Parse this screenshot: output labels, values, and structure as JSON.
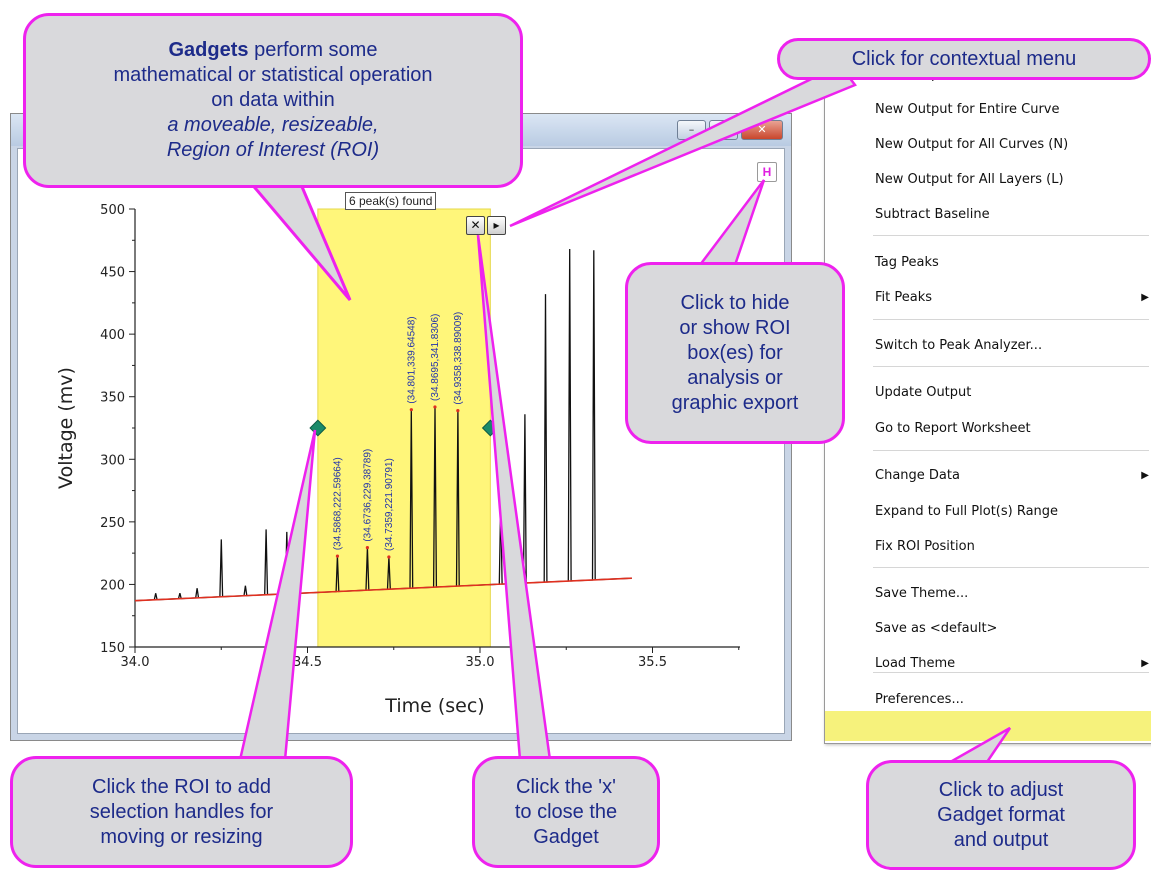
{
  "graph": {
    "window_buttons": {
      "minimize": "–",
      "maximize": "▫",
      "close": "✕"
    },
    "h_button_label": "H",
    "roi_label": "6 peak(s) found",
    "roi_close": "✕",
    "roi_menu": "▸",
    "xlabel": "Time (sec)",
    "ylabel": "Voltage (mv)",
    "x_ticks": [
      "34.0",
      "34.5",
      "35.0",
      "35.5"
    ],
    "y_ticks": [
      "500",
      "450",
      "400",
      "350",
      "300",
      "250",
      "200",
      "150"
    ],
    "peak_labels": [
      "(34.5868,222.59664)",
      "(34.6736,229.38789)",
      "(34.7359,221.90791)",
      "(34.801,339.64548)",
      "(34.8695,341.8306)",
      "(34.9358,338.89009)"
    ]
  },
  "chart_data": {
    "type": "line",
    "xlabel": "Time (sec)",
    "ylabel": "Voltage (mv)",
    "xlim": [
      34.0,
      35.75
    ],
    "ylim": [
      150,
      500
    ],
    "roi": [
      34.53,
      35.03
    ],
    "baseline": {
      "x": [
        34.0,
        35.44
      ],
      "y": [
        187,
        205
      ]
    },
    "peaks": [
      {
        "x": 34.06,
        "y": 193
      },
      {
        "x": 34.13,
        "y": 193
      },
      {
        "x": 34.18,
        "y": 197
      },
      {
        "x": 34.25,
        "y": 236
      },
      {
        "x": 34.32,
        "y": 199
      },
      {
        "x": 34.38,
        "y": 244
      },
      {
        "x": 34.44,
        "y": 242
      },
      {
        "x": 34.5868,
        "y": 222.59664
      },
      {
        "x": 34.6736,
        "y": 229.38789
      },
      {
        "x": 34.7359,
        "y": 221.90791
      },
      {
        "x": 34.801,
        "y": 339.64548
      },
      {
        "x": 34.8695,
        "y": 341.8306
      },
      {
        "x": 34.9358,
        "y": 338.89009
      },
      {
        "x": 35.06,
        "y": 267
      },
      {
        "x": 35.13,
        "y": 336
      },
      {
        "x": 35.19,
        "y": 432
      },
      {
        "x": 35.26,
        "y": 468
      },
      {
        "x": 35.33,
        "y": 467
      }
    ]
  },
  "menu": {
    "items": [
      {
        "label": "New Output (O)",
        "arrow": ""
      },
      {
        "label": "New Output for Entire Curve",
        "arrow": ""
      },
      {
        "label": "New Output for All Curves (N)",
        "arrow": ""
      },
      {
        "label": "New Output for All Layers (L)",
        "arrow": ""
      },
      {
        "label": "Subtract Baseline",
        "arrow": ""
      },
      {
        "label": "Tag Peaks",
        "arrow": ""
      },
      {
        "label": "Fit Peaks",
        "arrow": "▶"
      },
      {
        "label": "Switch to Peak Analyzer...",
        "arrow": ""
      },
      {
        "label": "Update Output",
        "arrow": ""
      },
      {
        "label": "Go to Report Worksheet",
        "arrow": ""
      },
      {
        "label": "Change Data",
        "arrow": "▶"
      },
      {
        "label": "Expand to Full Plot(s) Range",
        "arrow": ""
      },
      {
        "label": "Fix ROI Position",
        "arrow": ""
      },
      {
        "label": "Save Theme...",
        "arrow": ""
      },
      {
        "label": "Save as <default>",
        "arrow": ""
      },
      {
        "label": "Load Theme",
        "arrow": "▶"
      },
      {
        "label": "Preferences...",
        "arrow": ""
      }
    ]
  },
  "callouts": {
    "gadgets": {
      "bold": "Gadgets",
      "line1_rest": " perform some",
      "line2": "mathematical or statistical operation",
      "line3": "on data within",
      "line4": "a moveable, resizeable,",
      "line5": "Region of Interest (ROI)"
    },
    "context": "Click for contextual menu",
    "hide": "Click to hide\nor show ROI\nbox(es) for\nanalysis or\ngraphic export",
    "roi": "Click the ROI to add\nselection handles for\nmoving or resizing",
    "close": "Click the 'x'\nto close the\nGadget",
    "prefs": "Click to adjust\nGadget format\nand output"
  },
  "colors": {
    "callout_border": "#ee22ee",
    "callout_fill": "#d9d9dc",
    "callout_text": "#1d2b8a",
    "roi_fill": "#fff67a",
    "baseline": "#e03020",
    "highlight": "#f6f27c"
  }
}
